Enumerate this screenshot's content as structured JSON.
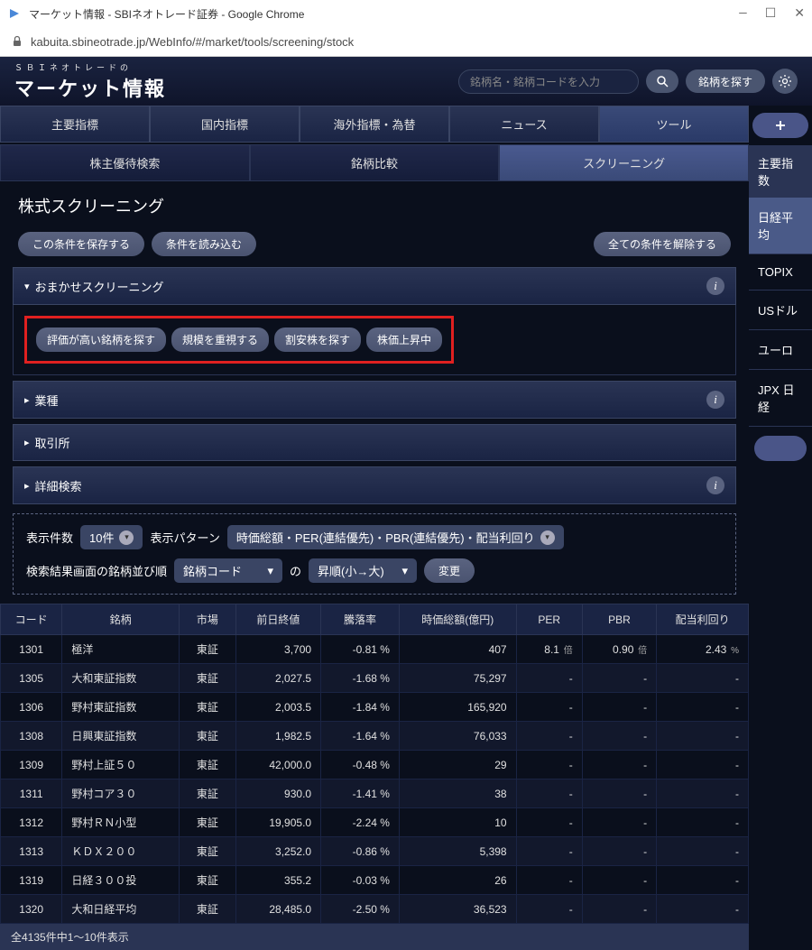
{
  "window": {
    "title": "マーケット情報 - SBIネオトレード証券 - Google Chrome",
    "url": "kabuita.sbineotrade.jp/WebInfo/#/market/tools/screening/stock"
  },
  "header": {
    "brand_sub": "ＳＢＩネオトレードの",
    "brand_main": "マーケット情報",
    "search_placeholder": "銘柄名・銘柄コードを入力",
    "find_label": "銘柄を探す"
  },
  "main_tabs": [
    "主要指標",
    "国内指標",
    "海外指標・為替",
    "ニュース",
    "ツール"
  ],
  "sub_tabs": [
    "株主優待検索",
    "銘柄比較",
    "スクリーニング"
  ],
  "page_title": "株式スクリーニング",
  "controls": {
    "save": "この条件を保存する",
    "load": "条件を読み込む",
    "clear": "全ての条件を解除する"
  },
  "sections": {
    "omakase": "おまかせスクリーニング",
    "industry": "業種",
    "exchange": "取引所",
    "detail": "詳細検索"
  },
  "chips": [
    "評価が高い銘柄を探す",
    "規模を重視する",
    "割安株を探す",
    "株価上昇中"
  ],
  "options": {
    "count_label": "表示件数",
    "count_value": "10件",
    "pattern_label": "表示パターン",
    "pattern_value": "時価総額・PER(連結優先)・PBR(連結優先)・配当利回り",
    "sort_label": "検索結果画面の銘柄並び順",
    "sort_field": "銘柄コード",
    "sort_sep": "の",
    "sort_dir": "昇順(小→大)",
    "change": "変更"
  },
  "table": {
    "headers": [
      "コード",
      "銘柄",
      "市場",
      "前日終値",
      "騰落率",
      "時価総額(億円)",
      "PER",
      "PBR",
      "配当利回り"
    ],
    "rows": [
      {
        "code": "1301",
        "name": "極洋",
        "market": "東証",
        "close": "3,700",
        "change": "-0.81",
        "cap": "407",
        "per": "8.1",
        "pbr": "0.90",
        "yield": "2.43"
      },
      {
        "code": "1305",
        "name": "大和東証指数",
        "market": "東証",
        "close": "2,027.5",
        "change": "-1.68",
        "cap": "75,297",
        "per": "-",
        "pbr": "-",
        "yield": "-"
      },
      {
        "code": "1306",
        "name": "野村東証指数",
        "market": "東証",
        "close": "2,003.5",
        "change": "-1.84",
        "cap": "165,920",
        "per": "-",
        "pbr": "-",
        "yield": "-"
      },
      {
        "code": "1308",
        "name": "日興東証指数",
        "market": "東証",
        "close": "1,982.5",
        "change": "-1.64",
        "cap": "76,033",
        "per": "-",
        "pbr": "-",
        "yield": "-"
      },
      {
        "code": "1309",
        "name": "野村上証５０",
        "market": "東証",
        "close": "42,000.0",
        "change": "-0.48",
        "cap": "29",
        "per": "-",
        "pbr": "-",
        "yield": "-"
      },
      {
        "code": "1311",
        "name": "野村コア３０",
        "market": "東証",
        "close": "930.0",
        "change": "-1.41",
        "cap": "38",
        "per": "-",
        "pbr": "-",
        "yield": "-"
      },
      {
        "code": "1312",
        "name": "野村ＲＮ小型",
        "market": "東証",
        "close": "19,905.0",
        "change": "-2.24",
        "cap": "10",
        "per": "-",
        "pbr": "-",
        "yield": "-"
      },
      {
        "code": "1313",
        "name": "ＫＤＸ２００",
        "market": "東証",
        "close": "3,252.0",
        "change": "-0.86",
        "cap": "5,398",
        "per": "-",
        "pbr": "-",
        "yield": "-"
      },
      {
        "code": "1319",
        "name": "日経３００投",
        "market": "東証",
        "close": "355.2",
        "change": "-0.03",
        "cap": "26",
        "per": "-",
        "pbr": "-",
        "yield": "-"
      },
      {
        "code": "1320",
        "name": "大和日経平均",
        "market": "東証",
        "close": "28,485.0",
        "change": "-2.50",
        "cap": "36,523",
        "per": "-",
        "pbr": "-",
        "yield": "-"
      }
    ],
    "footer": "全4135件中1～10件表示"
  },
  "sidebar": {
    "head": "主要指数",
    "items": [
      "日経平均",
      "TOPIX",
      "USドル",
      "ユーロ",
      "JPX 日経"
    ]
  }
}
